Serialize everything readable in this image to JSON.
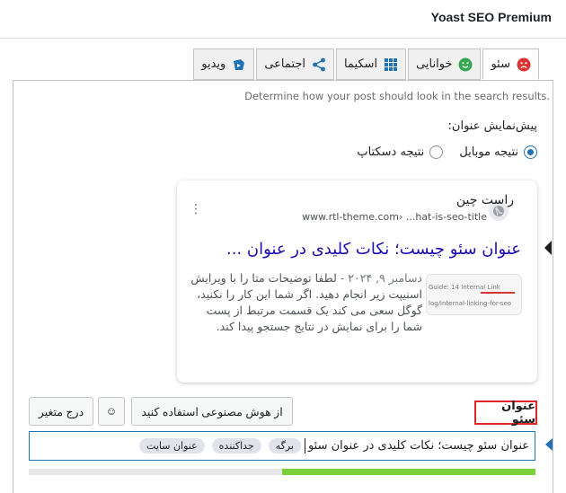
{
  "header": {
    "title": "Yoast SEO Premium"
  },
  "tabs": [
    {
      "label": "سئو",
      "icon": "sad-face-icon",
      "active": true
    },
    {
      "label": "خوانایی",
      "icon": "smiley-face-icon",
      "active": false
    },
    {
      "label": "اسکیما",
      "icon": "grid-icon",
      "active": false
    },
    {
      "label": "اجتماعی",
      "icon": "share-icon",
      "active": false
    },
    {
      "label": "ویدیو",
      "icon": "video-icon",
      "active": false
    }
  ],
  "preview": {
    "description": "Determine how your post should look in the search results.",
    "label": "پیش‌نمایش عنوان:",
    "mobile_label": "نتیجه موبایل",
    "desktop_label": "نتیجه دسکتاپ",
    "selected": "mobile"
  },
  "card": {
    "site_name": "راست چین",
    "url": "www.rtl-theme.com› ...hat-is-seo-title",
    "title": "عنوان سئو چیست؛ نکات کلیدی در عنوان ...",
    "date": "دسامبر ۹, ۲۰۲۴ -",
    "snippet": "لطفا توضیحات متا را با ویرایش اسنیپت زیر انجام دهید. اگر شما این کار را نکنید، گوگل سعی می کند یک قسمت مرتبط از پست شما را برای نمایش در نتایج جستجو پیدا کند.",
    "thumb_line1": "Guide: 14  Internal Link",
    "thumb_line2": "log/internal-linking-for-seo"
  },
  "seo_title": {
    "label": "عنوان سئو",
    "ai_button": "از هوش مصنوعی استفاده کنید",
    "emoji_button": "☺",
    "insert_button": "درج متغیر",
    "value": "عنوان سئو چیست؛ نکات کلیدی در عنوان سئو",
    "pills": [
      "برگه",
      "جداکننده",
      "عنوان سایت"
    ],
    "progress": 0.5
  },
  "colors": {
    "accent": "#2271b1",
    "bad": "#dc3232",
    "good": "#7ad03a",
    "link": "#1a0dab"
  }
}
